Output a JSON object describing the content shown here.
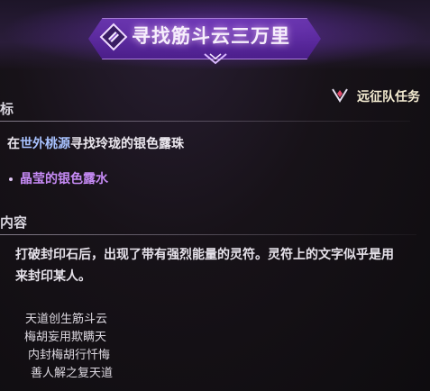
{
  "header": {
    "title": "寻找筋斗云三万里",
    "quest_icon": "scroll-quest-icon"
  },
  "expedition": {
    "label": "远征队任务",
    "icon": "diamond-quest-icon"
  },
  "objective_section": {
    "title": "标",
    "text_before": "在",
    "location": "世外桃源",
    "text_after": "寻找玲珑的银色露珠",
    "sub_item": "晶莹的银色露水"
  },
  "content_section": {
    "title": "内容",
    "description_lines": [
      "打破封印石后，出现了带有强烈能量的灵符。灵符上的文字似乎是用",
      "来封印某人。"
    ],
    "poem": [
      "天道创生筋斗云",
      "梅胡妄用欺瞒天",
      "内封梅胡行忏悔",
      "善人解之复天道"
    ]
  },
  "colors": {
    "accent_purple": "#a85cff",
    "location_blue": "#a8c2ff",
    "sub_item_violet": "#c58af4"
  }
}
